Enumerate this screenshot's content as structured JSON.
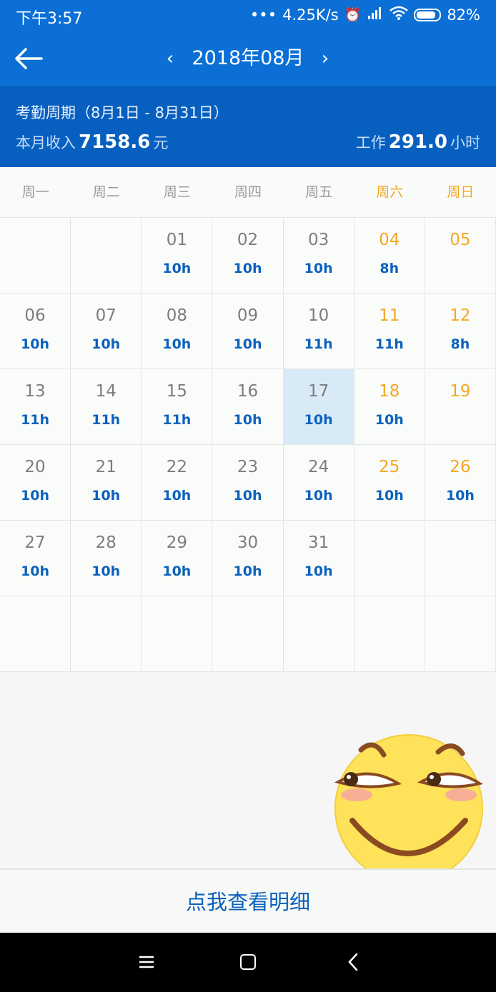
{
  "statusbar": {
    "time": "下午3:57",
    "dots": "•••",
    "speed": "4.25K/s",
    "alarm_icon": "alarm-icon",
    "signal_icon": "hd-signal-icon",
    "wifi_icon": "wifi-icon",
    "battery": "82%"
  },
  "appbar": {
    "back_icon": "arrow-left-icon",
    "prev_glyph": "‹",
    "next_glyph": "›",
    "month": "2018年08月"
  },
  "summary": {
    "cycle": "考勤周期（8月1日 - 8月31日）",
    "income_label": "本月收入",
    "income_value": "7158.6",
    "income_unit": "元",
    "work_label": "工作",
    "work_value": "291.0",
    "work_unit": "小时"
  },
  "weekdays": [
    "周一",
    "周二",
    "周三",
    "周四",
    "周五",
    "周六",
    "周日"
  ],
  "colors": {
    "primary": "#0b6fd6",
    "summary_bg": "#0760c0",
    "weekend": "#f5a623",
    "hours": "#0b62bd",
    "today_bg": "#d9eaf7"
  },
  "calendar": [
    {
      "day": "",
      "hours": ""
    },
    {
      "day": "",
      "hours": ""
    },
    {
      "day": "01",
      "hours": "10h"
    },
    {
      "day": "02",
      "hours": "10h"
    },
    {
      "day": "03",
      "hours": "10h"
    },
    {
      "day": "04",
      "hours": "8h"
    },
    {
      "day": "05",
      "hours": ""
    },
    {
      "day": "06",
      "hours": "10h"
    },
    {
      "day": "07",
      "hours": "10h"
    },
    {
      "day": "08",
      "hours": "10h"
    },
    {
      "day": "09",
      "hours": "10h"
    },
    {
      "day": "10",
      "hours": "11h"
    },
    {
      "day": "11",
      "hours": "11h"
    },
    {
      "day": "12",
      "hours": "8h"
    },
    {
      "day": "13",
      "hours": "11h"
    },
    {
      "day": "14",
      "hours": "11h"
    },
    {
      "day": "15",
      "hours": "11h"
    },
    {
      "day": "16",
      "hours": "10h"
    },
    {
      "day": "17",
      "hours": "10h",
      "today": true
    },
    {
      "day": "18",
      "hours": "10h"
    },
    {
      "day": "19",
      "hours": ""
    },
    {
      "day": "20",
      "hours": "10h"
    },
    {
      "day": "21",
      "hours": "10h"
    },
    {
      "day": "22",
      "hours": "10h"
    },
    {
      "day": "23",
      "hours": "10h"
    },
    {
      "day": "24",
      "hours": "10h"
    },
    {
      "day": "25",
      "hours": "10h"
    },
    {
      "day": "26",
      "hours": "10h"
    },
    {
      "day": "27",
      "hours": "10h"
    },
    {
      "day": "28",
      "hours": "10h"
    },
    {
      "day": "29",
      "hours": "10h"
    },
    {
      "day": "30",
      "hours": "10h"
    },
    {
      "day": "31",
      "hours": "10h"
    },
    {
      "day": "",
      "hours": ""
    },
    {
      "day": "",
      "hours": ""
    },
    {
      "day": "",
      "hours": ""
    },
    {
      "day": "",
      "hours": ""
    },
    {
      "day": "",
      "hours": ""
    },
    {
      "day": "",
      "hours": ""
    },
    {
      "day": "",
      "hours": ""
    },
    {
      "day": "",
      "hours": ""
    },
    {
      "day": "",
      "hours": ""
    }
  ],
  "floating": {
    "icon": "smirk-emoji-icon"
  },
  "bottom_button": "点我查看明细",
  "navbar": {
    "menu_icon": "menu-icon",
    "home_icon": "home-icon",
    "back_icon": "back-icon"
  }
}
